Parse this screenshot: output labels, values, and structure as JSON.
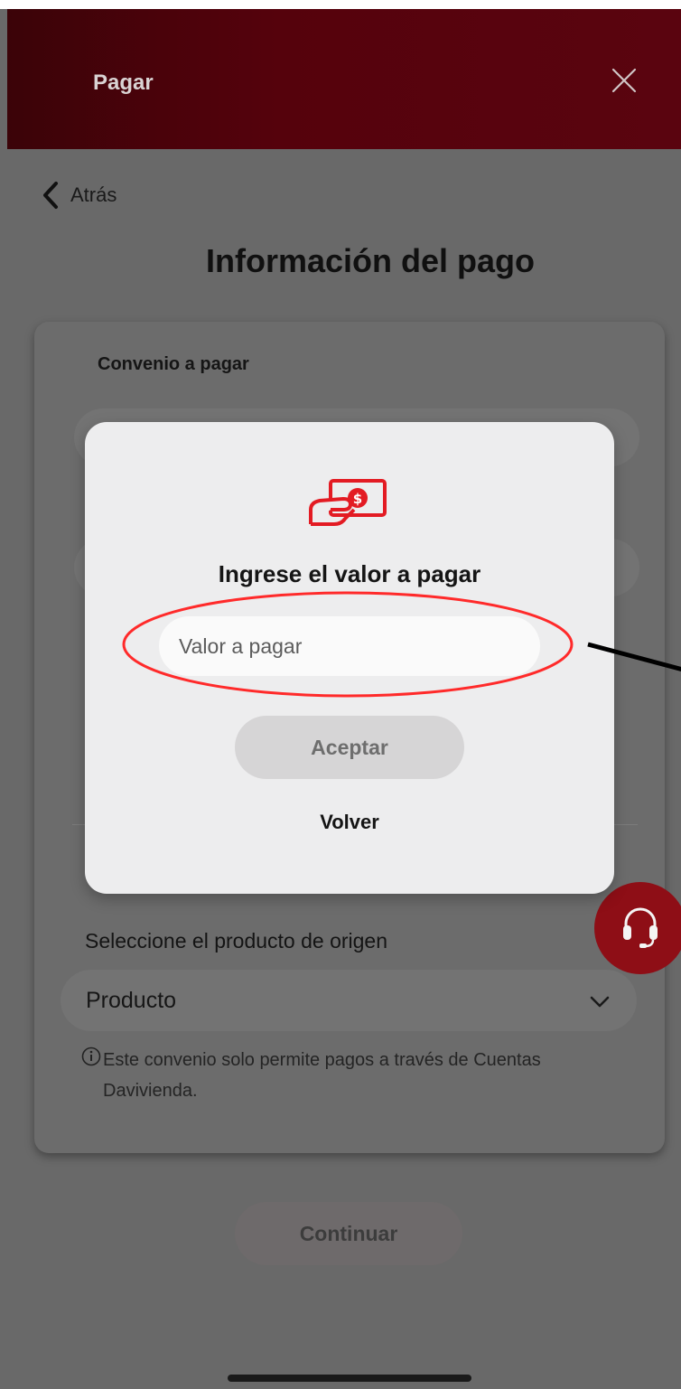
{
  "app_bar": {
    "title": "Pagar",
    "close_icon": "close-icon"
  },
  "nav": {
    "back_label": "Atrás"
  },
  "page": {
    "title": "Información del pago"
  },
  "form": {
    "agreement_label": "Convenio a pagar",
    "origin_label": "Seleccione el producto de origen",
    "origin_select_value": "Producto",
    "info_text": "Este convenio solo permite pagos a través de Cuentas Davivienda.",
    "continue_label": "Continuar"
  },
  "modal": {
    "icon": "cash-payment-icon",
    "title": "Ingrese el valor a pagar",
    "amount_placeholder": "Valor a pagar",
    "accept_label": "Aceptar",
    "back_label": "Volver"
  },
  "colors": {
    "brand_red": "#e31b23",
    "app_bar": "#55020c",
    "overlay_gray": "#696969",
    "annotation_red": "#ff2a2a"
  }
}
